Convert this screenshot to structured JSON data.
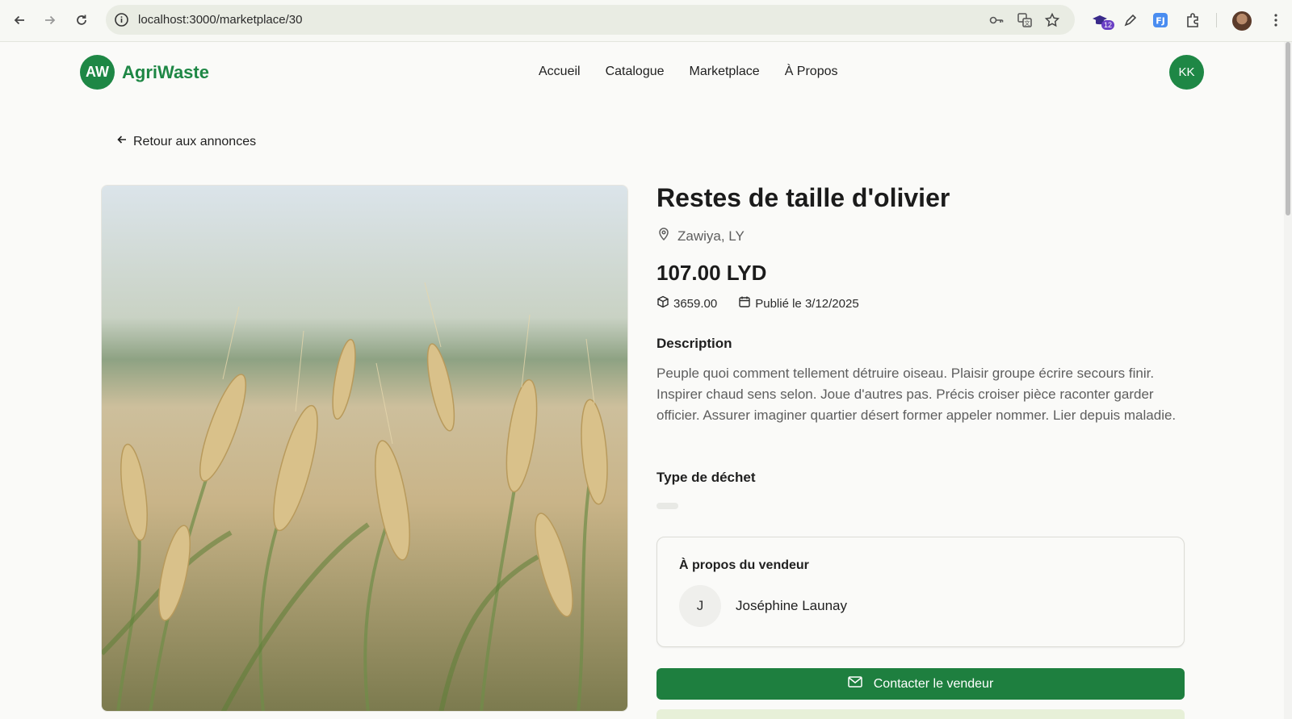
{
  "browser": {
    "url": "localhost:3000/marketplace/30",
    "extension_badge": "12"
  },
  "header": {
    "logo_initials": "AW",
    "brand": "AgriWaste",
    "nav": [
      {
        "label": "Accueil"
      },
      {
        "label": "Catalogue"
      },
      {
        "label": "Marketplace"
      },
      {
        "label": "À Propos"
      }
    ],
    "user_initials": "KK"
  },
  "back_link": "Retour aux annonces",
  "listing": {
    "title": "Restes de taille d'olivier",
    "location": "Zawiya, LY",
    "price": "107.00 LYD",
    "quantity": "3659.00",
    "published": "Publié le 3/12/2025",
    "description_heading": "Description",
    "description": "Peuple quoi comment tellement détruire oiseau. Plaisir groupe écrire secours finir. Inspirer chaud sens selon. Joue d'autres pas. Précis croiser pièce raconter garder officier. Assurer imaginer quartier désert former appeler nommer. Lier depuis maladie.",
    "type_heading": "Type de déchet",
    "image_subject": "wheat-field-photo"
  },
  "seller": {
    "heading": "À propos du vendeur",
    "initial": "J",
    "name": "Joséphine Launay"
  },
  "actions": {
    "contact_label": "Contacter le vendeur"
  },
  "colors": {
    "brand_green": "#1e8745",
    "button_green": "#1e7f3f"
  }
}
